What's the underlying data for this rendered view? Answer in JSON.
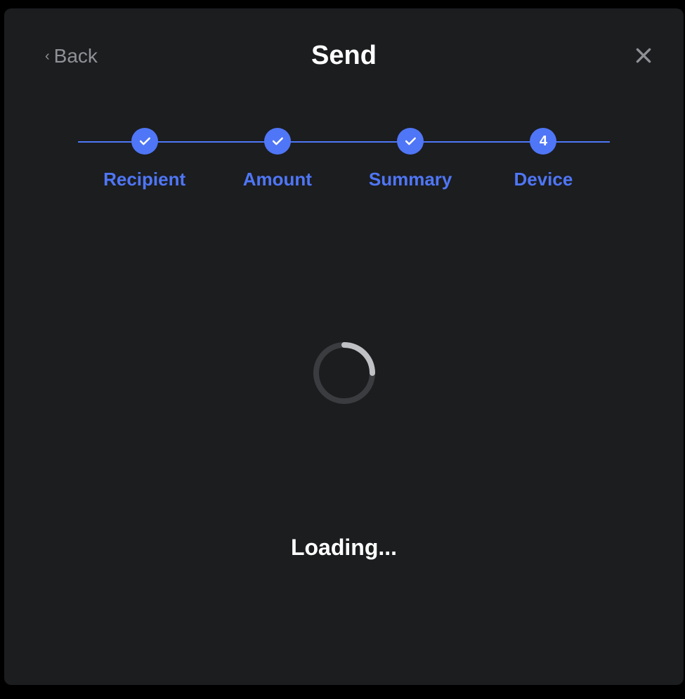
{
  "header": {
    "back_label": "Back",
    "title": "Send"
  },
  "stepper": {
    "steps": [
      {
        "label": "Recipient",
        "state": "done"
      },
      {
        "label": "Amount",
        "state": "done"
      },
      {
        "label": "Summary",
        "state": "done"
      },
      {
        "label": "Device",
        "state": "current",
        "number": "4"
      }
    ]
  },
  "body": {
    "loading_text": "Loading..."
  },
  "colors": {
    "accent": "#4f76f6",
    "bg": "#1b1d1f",
    "muted": "#8f9196"
  }
}
